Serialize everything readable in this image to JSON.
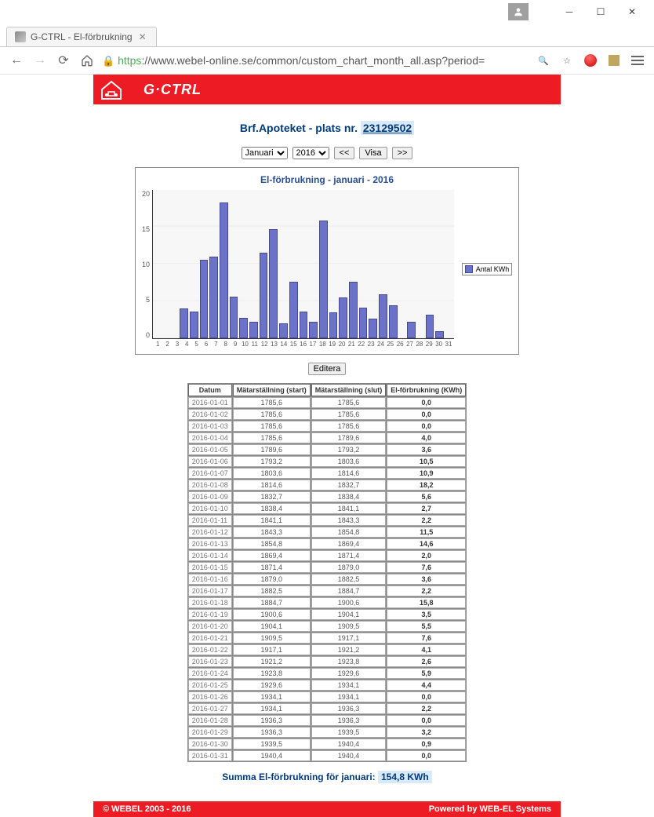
{
  "window": {
    "tab_title": "G-CTRL - El-förbrukning",
    "url_https": "https",
    "url_rest": "://www.webel-online.se/common/custom_chart_month_all.asp?period="
  },
  "banner": {
    "brand": "G·CTRL"
  },
  "header": {
    "prefix": "Brf.Apoteket - plats nr.",
    "id": "23129502"
  },
  "controls": {
    "month_options": [
      "Januari"
    ],
    "month_selected": "Januari",
    "year_options": [
      "2016"
    ],
    "year_selected": "2016",
    "prev": "<<",
    "show": "Visa",
    "next": ">>"
  },
  "chart_data": {
    "type": "bar",
    "title": "El-förbrukning - januari - 2016",
    "xlabel": "",
    "ylabel": "",
    "ylim": [
      0,
      20
    ],
    "yticks": [
      0,
      5,
      10,
      15,
      20
    ],
    "legend": "Antal KWh",
    "categories": [
      1,
      2,
      3,
      4,
      5,
      6,
      7,
      8,
      9,
      10,
      11,
      12,
      13,
      14,
      15,
      16,
      17,
      18,
      19,
      20,
      21,
      22,
      23,
      24,
      25,
      26,
      27,
      28,
      29,
      30,
      31
    ],
    "values": [
      0.0,
      0.0,
      0.0,
      4.0,
      3.6,
      10.5,
      10.9,
      18.2,
      5.6,
      2.7,
      2.2,
      11.5,
      14.6,
      2.0,
      7.6,
      3.6,
      2.2,
      15.8,
      3.5,
      5.5,
      7.6,
      4.1,
      2.6,
      5.9,
      4.4,
      0.0,
      2.2,
      0.0,
      3.2,
      0.9,
      0.0
    ]
  },
  "edit_button": "Editera",
  "table": {
    "cols": [
      "Datum",
      "Mätarställning (start)",
      "Mätarställning (slut)",
      "El-förbrukning (KWh)"
    ],
    "rows": [
      {
        "d": "2016-01-01",
        "s": "1785,6",
        "e": "1785,6",
        "v": "0,0"
      },
      {
        "d": "2016-01-02",
        "s": "1785,6",
        "e": "1785,6",
        "v": "0,0"
      },
      {
        "d": "2016-01-03",
        "s": "1785,6",
        "e": "1785,6",
        "v": "0,0"
      },
      {
        "d": "2016-01-04",
        "s": "1785,6",
        "e": "1789,6",
        "v": "4,0"
      },
      {
        "d": "2016-01-05",
        "s": "1789,6",
        "e": "1793,2",
        "v": "3,6"
      },
      {
        "d": "2016-01-06",
        "s": "1793,2",
        "e": "1803,6",
        "v": "10,5"
      },
      {
        "d": "2016-01-07",
        "s": "1803,6",
        "e": "1814,6",
        "v": "10,9"
      },
      {
        "d": "2016-01-08",
        "s": "1814,6",
        "e": "1832,7",
        "v": "18,2"
      },
      {
        "d": "2016-01-09",
        "s": "1832,7",
        "e": "1838,4",
        "v": "5,6"
      },
      {
        "d": "2016-01-10",
        "s": "1838,4",
        "e": "1841,1",
        "v": "2,7"
      },
      {
        "d": "2016-01-11",
        "s": "1841,1",
        "e": "1843,3",
        "v": "2,2"
      },
      {
        "d": "2016-01-12",
        "s": "1843,3",
        "e": "1854,8",
        "v": "11,5"
      },
      {
        "d": "2016-01-13",
        "s": "1854,8",
        "e": "1869,4",
        "v": "14,6"
      },
      {
        "d": "2016-01-14",
        "s": "1869,4",
        "e": "1871,4",
        "v": "2,0"
      },
      {
        "d": "2016-01-15",
        "s": "1871,4",
        "e": "1879,0",
        "v": "7,6"
      },
      {
        "d": "2016-01-16",
        "s": "1879,0",
        "e": "1882,5",
        "v": "3,6"
      },
      {
        "d": "2016-01-17",
        "s": "1882,5",
        "e": "1884,7",
        "v": "2,2"
      },
      {
        "d": "2016-01-18",
        "s": "1884,7",
        "e": "1900,6",
        "v": "15,8"
      },
      {
        "d": "2016-01-19",
        "s": "1900,6",
        "e": "1904,1",
        "v": "3,5"
      },
      {
        "d": "2016-01-20",
        "s": "1904,1",
        "e": "1909,5",
        "v": "5,5"
      },
      {
        "d": "2016-01-21",
        "s": "1909,5",
        "e": "1917,1",
        "v": "7,6"
      },
      {
        "d": "2016-01-22",
        "s": "1917,1",
        "e": "1921,2",
        "v": "4,1"
      },
      {
        "d": "2016-01-23",
        "s": "1921,2",
        "e": "1923,8",
        "v": "2,6"
      },
      {
        "d": "2016-01-24",
        "s": "1923,8",
        "e": "1929,6",
        "v": "5,9"
      },
      {
        "d": "2016-01-25",
        "s": "1929,6",
        "e": "1934,1",
        "v": "4,4"
      },
      {
        "d": "2016-01-26",
        "s": "1934,1",
        "e": "1934,1",
        "v": "0,0"
      },
      {
        "d": "2016-01-27",
        "s": "1934,1",
        "e": "1936,3",
        "v": "2,2"
      },
      {
        "d": "2016-01-28",
        "s": "1936,3",
        "e": "1936,3",
        "v": "0,0"
      },
      {
        "d": "2016-01-29",
        "s": "1936,3",
        "e": "1939,5",
        "v": "3,2"
      },
      {
        "d": "2016-01-30",
        "s": "1939,5",
        "e": "1940,4",
        "v": "0,9"
      },
      {
        "d": "2016-01-31",
        "s": "1940,4",
        "e": "1940,4",
        "v": "0,0"
      }
    ]
  },
  "summary": {
    "label": "Summa El-förbrukning för januari:",
    "value": "154,8 KWh"
  },
  "footer": {
    "left": "© WEBEL 2003 - 2016",
    "right": "Powered by WEB-EL Systems"
  }
}
